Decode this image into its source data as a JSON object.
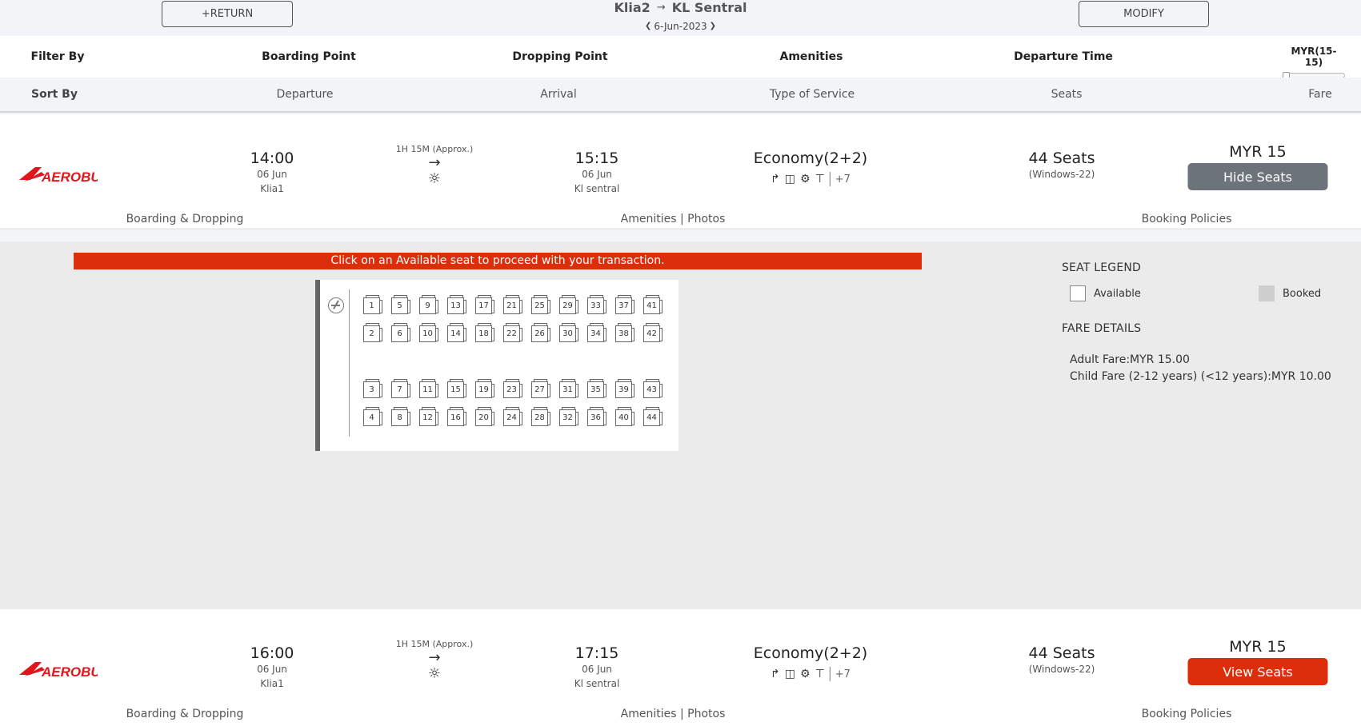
{
  "header": {
    "return_label": "+RETURN",
    "from": "Klia2",
    "arrow": "→",
    "to": "KL Sentral",
    "date": "6-Jun-2023",
    "modify_label": "MODIFY"
  },
  "filter": {
    "filter_by": "Filter By",
    "boarding_point": "Boarding Point",
    "dropping_point": "Dropping Point",
    "amenities": "Amenities",
    "departure_time": "Departure Time",
    "fare_range": "MYR(15-15)"
  },
  "sort": {
    "sort_by": "Sort By",
    "departure": "Departure",
    "arrival": "Arrival",
    "type_of_service": "Type of Service",
    "seats": "Seats",
    "fare": "Fare"
  },
  "trips": [
    {
      "operator": "AEROBUS",
      "depart_time": "14:00",
      "depart_date": "06 Jun",
      "depart_place": "Klia1",
      "duration": "1H 15M (Approx.)",
      "arrive_time": "15:15",
      "arrive_date": "06 Jun",
      "arrive_place": "Kl sentral",
      "service": "Economy(2+2)",
      "amenities_more": "+7",
      "seats": "44 Seats",
      "windows": "(Windows-22)",
      "fare": "MYR 15",
      "button": "Hide Seats",
      "boarding_dropping": "Boarding & Dropping",
      "amenities_link": "Amenities",
      "pipe": "|",
      "photos_link": "Photos",
      "policies": "Booking Policies"
    },
    {
      "operator": "AEROBUS",
      "depart_time": "16:00",
      "depart_date": "06 Jun",
      "depart_place": "Klia1",
      "duration": "1H 15M (Approx.)",
      "arrive_time": "17:15",
      "arrive_date": "06 Jun",
      "arrive_place": "Kl sentral",
      "service": "Economy(2+2)",
      "amenities_more": "+7",
      "seats": "44 Seats",
      "windows": "(Windows-22)",
      "fare": "MYR 15",
      "button": "View Seats",
      "boarding_dropping": "Boarding & Dropping",
      "amenities_link": "Amenities",
      "pipe": "|",
      "photos_link": "Photos",
      "policies": "Booking Policies"
    }
  ],
  "seat_panel": {
    "banner": "Click on an Available seat to proceed with your transaction.",
    "seat_rows": [
      [
        "1",
        "5",
        "9",
        "13",
        "17",
        "21",
        "25",
        "29",
        "33",
        "37",
        "41"
      ],
      [
        "2",
        "6",
        "10",
        "14",
        "18",
        "22",
        "26",
        "30",
        "34",
        "38",
        "42"
      ],
      [
        "3",
        "7",
        "11",
        "15",
        "19",
        "23",
        "27",
        "31",
        "35",
        "39",
        "43"
      ],
      [
        "4",
        "8",
        "12",
        "16",
        "20",
        "24",
        "28",
        "32",
        "36",
        "40",
        "44"
      ]
    ],
    "legend_title": "SEAT LEGEND",
    "available": "Available",
    "booked": "Booked",
    "fare_title": "FARE DETAILS",
    "adult_fare": "Adult Fare:MYR 15.00",
    "child_fare": "Child Fare (2-12 years) (<12 years):MYR 10.00"
  },
  "colors": {
    "accent_red": "#dc2e0a",
    "hide_btn": "#6c737a",
    "booked_gray": "#cfcfcf"
  },
  "icons": [
    "steering-wheel-icon",
    "sun-icon",
    "arrow-right-icon",
    "amenity-icons"
  ]
}
